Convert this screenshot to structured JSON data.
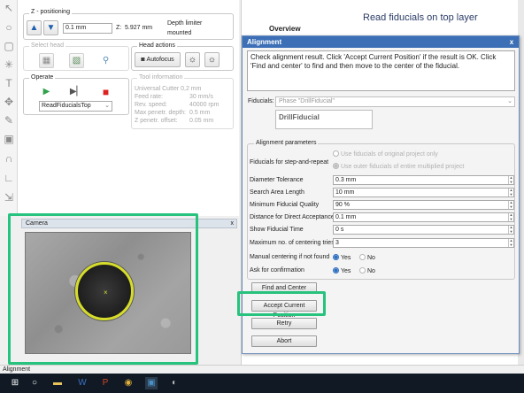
{
  "left_toolbar": {
    "icons": [
      "select-arrow-icon",
      "circle-icon",
      "square-icon",
      "star-icon",
      "text-icon",
      "crosshair-icon",
      "pen-icon",
      "layer-icon",
      "arch-icon",
      "measure-icon",
      "unit-icon"
    ]
  },
  "z_positioning": {
    "title": "Z - positioning",
    "step_value": "0.1 mm",
    "z_label": "Z:",
    "z_value": "5.927 mm",
    "depth_limiter_label": "Depth limiter",
    "depth_limiter_value": "mounted"
  },
  "select_head": {
    "title": "Select head"
  },
  "head_actions": {
    "title": "Head actions",
    "autofocus_label": "Autofocus"
  },
  "operate": {
    "title": "Operate",
    "program": "ReadFiducialsTop"
  },
  "tool_info": {
    "title": "Tool information",
    "tool_name": "Universal Cutter 0,2 mm",
    "rows": [
      {
        "label": "Feed rate:",
        "value": "30 mm/s"
      },
      {
        "label": "Rev. speed:",
        "value": "40000 rpm"
      },
      {
        "label": "Max penetr. depth:",
        "value": "0.5 mm"
      },
      {
        "label": "Z penetr. offset:",
        "value": "0.05 mm"
      }
    ]
  },
  "camera": {
    "title": "Camera",
    "close_label": "x"
  },
  "background_doc": {
    "overview": "Overview",
    "title": "Read fiducials on top layer"
  },
  "dialog": {
    "title": "Alignment",
    "close_label": "x",
    "message": "Check alignment result. Click 'Accept Current Position' if the result is OK. Click 'Find and center' to find and then move to the center of the fiducial.",
    "fiducials_label": "Fiducials:",
    "phase_value": "Phase \"DrillFiducial\"",
    "fiducial_name": "DrillFiducial",
    "params_title": "Alignment parameters",
    "step_repeat_label": "Fiducials for step-and-repeat",
    "step_repeat_options": [
      "Use fiducials of original project only",
      "Use outer fiducials of entire multiplied project"
    ],
    "fields": [
      {
        "label": "Diameter Tolerance",
        "value": "0.3 mm"
      },
      {
        "label": "Search Area Length",
        "value": "10 mm"
      },
      {
        "label": "Minimum Fiducial Quality",
        "value": "90 %"
      },
      {
        "label": "Distance for Direct Acceptance",
        "value": "0.1 mm"
      },
      {
        "label": "Show Fiducial Time",
        "value": "0 s"
      },
      {
        "label": "Maximum no. of centering tries",
        "value": "3"
      }
    ],
    "manual_centering_label": "Manual centering if not found",
    "confirm_label": "Ask for confirmation",
    "yes_label": "Yes",
    "no_label": "No",
    "buttons": {
      "find_center": "Find and Center",
      "accept": "Accept Current Position",
      "retry": "Retry",
      "abort": "Abort"
    }
  },
  "status": {
    "text": "Alignment"
  },
  "taskbar": {
    "icons": [
      "windows-start-icon",
      "search-icon",
      "task-view-icon",
      "file-explorer-icon",
      "word-icon",
      "powerpoint-icon",
      "chrome-icon",
      "app-icon",
      "browser-icon"
    ]
  },
  "colors": {
    "highlight": "#27c27d",
    "dialog_title": "#3c6fb6",
    "fiducial_ring": "#d6dc2a"
  }
}
